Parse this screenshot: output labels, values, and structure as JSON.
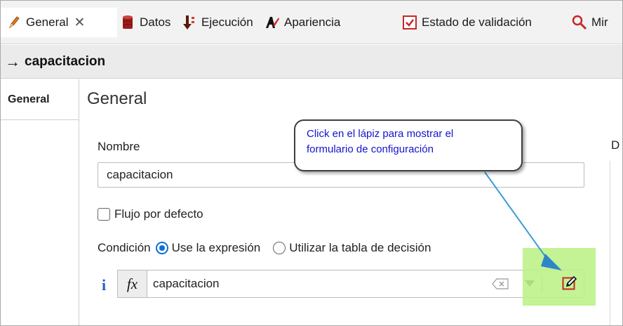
{
  "tabs": [
    {
      "label": "General",
      "icon": "pencil-icon",
      "active": true,
      "closable": true
    },
    {
      "label": "Datos",
      "icon": "database-icon"
    },
    {
      "label": "Ejecución",
      "icon": "run-icon"
    },
    {
      "label": "Apariencia",
      "icon": "appearance-icon"
    },
    {
      "label": "Estado de validación",
      "icon": "validation-check-icon"
    },
    {
      "label": "Mir",
      "icon": "magnifier-icon"
    }
  ],
  "header": {
    "arrow": "→",
    "title": "capacitacion"
  },
  "side_tabs": [
    {
      "label": "General"
    }
  ],
  "form": {
    "section_title": "General",
    "name_label": "Nombre",
    "name_value": "capacitacion",
    "default_flow_label": "Flujo por defecto",
    "condition_label": "Condición",
    "option_expression": "Use la expresión",
    "option_decision_table": "Utilizar la tabla de decisión",
    "expression_fx": "fx",
    "expression_value": "capacitacion",
    "info_glyph": "i"
  },
  "right_panel": {
    "label": "D"
  },
  "callout": {
    "line1": "Click en el lápiz para mostrar el",
    "line2": "formulario de configuración"
  },
  "colors": {
    "accent": "#0d6fd3",
    "highlight": "#bdf28a",
    "callout_text": "#1414cc",
    "arrow": "#3a9bd6"
  }
}
